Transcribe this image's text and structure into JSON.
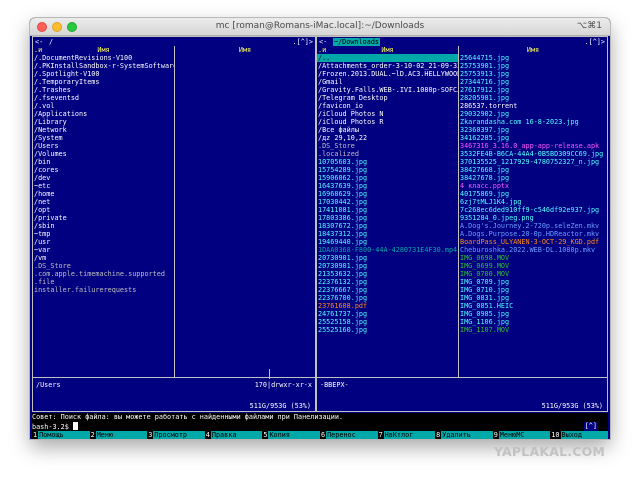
{
  "window": {
    "title": "mc [roman@Romans-iMac.local]:~/Downloads",
    "shortcut": "⌥⌘1"
  },
  "left_panel": {
    "menu": "<-",
    "path": "/",
    "indicator": ".[^]>",
    "col_sort": ".и",
    "col1_header": "Имя",
    "col2_header": "Имя",
    "col1": [
      {
        "name": "/.DocumentRevisions-V100",
        "color": "c-white"
      },
      {
        "name": "/.PKInstallSandbox-r-SystemSoftware",
        "color": "c-white"
      },
      {
        "name": "/.Spotlight-V100",
        "color": "c-white"
      },
      {
        "name": "/.TemporaryItems",
        "color": "c-white"
      },
      {
        "name": "/.Trashes",
        "color": "c-white"
      },
      {
        "name": "/.fseventsd",
        "color": "c-white"
      },
      {
        "name": "/.vol",
        "color": "c-white"
      },
      {
        "name": "/Applications",
        "color": "c-white"
      },
      {
        "name": "/Library",
        "color": "c-white"
      },
      {
        "name": "/Network",
        "color": "c-white"
      },
      {
        "name": "/System",
        "color": "c-white"
      },
      {
        "name": "/Users",
        "color": "c-white"
      },
      {
        "name": "/Volumes",
        "color": "c-white"
      },
      {
        "name": "/bin",
        "color": "c-white"
      },
      {
        "name": "/cores",
        "color": "c-white"
      },
      {
        "name": "/dev",
        "color": "c-white"
      },
      {
        "name": "~etc",
        "color": "c-white"
      },
      {
        "name": "/home",
        "color": "c-white"
      },
      {
        "name": "/net",
        "color": "c-white"
      },
      {
        "name": "/opt",
        "color": "c-white"
      },
      {
        "name": "/private",
        "color": "c-white"
      },
      {
        "name": "/sbin",
        "color": "c-white"
      },
      {
        "name": "~tmp",
        "color": "c-white"
      },
      {
        "name": "/usr",
        "color": "c-white"
      },
      {
        "name": "~var",
        "color": "c-white"
      },
      {
        "name": "/vm",
        "color": "c-white"
      },
      {
        "name": " .DS_Store",
        "color": "c-gray"
      },
      {
        "name": " .com.apple.timemachine.supported",
        "color": "c-gray"
      },
      {
        "name": " .file",
        "color": "c-gray"
      },
      {
        "name": " installer.failurerequests",
        "color": "c-gray"
      }
    ],
    "col2": [],
    "status_name": "/Users",
    "status_info": "170|drwxr-xr-x",
    "disk": "511G/953G (53%)"
  },
  "right_panel": {
    "menu": "<-",
    "path": "~/Downloads",
    "indicator": ".[^]>",
    "col_sort": ".и",
    "col1_header": "Имя",
    "col2_header": "Имя",
    "col1": [
      {
        "name": "/..",
        "color": "c-white",
        "selected": true
      },
      {
        "name": "/Attachments_order-3-10-02_21-09-32",
        "color": "c-white"
      },
      {
        "name": "/Frozen.2013.DUAL.~lD.AC3.HELLYWOOD",
        "color": "c-white"
      },
      {
        "name": "/Gmail",
        "color": "c-white"
      },
      {
        "name": "/Gravity.Falls.WEB-.IVI.1080p-SOFCJ",
        "color": "c-white"
      },
      {
        "name": "/Telegram Desktop",
        "color": "c-white"
      },
      {
        "name": "/favicon_io",
        "color": "c-white"
      },
      {
        "name": "/iCloud Photos N",
        "color": "c-white"
      },
      {
        "name": "/iCloud Photos R",
        "color": "c-white"
      },
      {
        "name": "/Все файлы",
        "color": "c-white"
      },
      {
        "name": "/дz 29,10,22",
        "color": "c-white"
      },
      {
        "name": " .DS_Store",
        "color": "c-gray"
      },
      {
        "name": " .localized",
        "color": "c-gray"
      },
      {
        "name": " 10705603.jpg",
        "color": "c-cyan"
      },
      {
        "name": " 15754289.jpg",
        "color": "c-cyan"
      },
      {
        "name": " 15906062.jpg",
        "color": "c-cyan"
      },
      {
        "name": " 16437639.jpg",
        "color": "c-cyan"
      },
      {
        "name": " 16968629.jpg",
        "color": "c-cyan"
      },
      {
        "name": " 17030442.jpg",
        "color": "c-cyan"
      },
      {
        "name": " 17411081.jpg",
        "color": "c-cyan"
      },
      {
        "name": " 17803386.jpg",
        "color": "c-cyan"
      },
      {
        "name": " 18307672.jpg",
        "color": "c-cyan"
      },
      {
        "name": " 18437312.jpg",
        "color": "c-cyan"
      },
      {
        "name": " 19469440.jpg",
        "color": "c-cyan"
      },
      {
        "name": " 1DAA0368-F800-44A-4280731E4F30.mp4",
        "color": "c-teal"
      },
      {
        "name": " 20730901.jpg",
        "color": "c-cyan"
      },
      {
        "name": " 20730901.jpg",
        "color": "c-cyan"
      },
      {
        "name": " 21353632.jpg",
        "color": "c-cyan"
      },
      {
        "name": " 22376132.jpg",
        "color": "c-cyan"
      },
      {
        "name": " 22376667.jpg",
        "color": "c-cyan"
      },
      {
        "name": " 22376700.jpg",
        "color": "c-cyan"
      },
      {
        "name": " 23761608.pdf",
        "color": "c-orange"
      },
      {
        "name": " 24761737.jpg",
        "color": "c-cyan"
      },
      {
        "name": " 25525158.jpg",
        "color": "c-cyan"
      },
      {
        "name": " 25525160.jpg",
        "color": "c-cyan"
      }
    ],
    "col2": [
      {
        "name": " 25644715.jpg",
        "color": "c-cyan"
      },
      {
        "name": " 25753901.jpg",
        "color": "c-cyan"
      },
      {
        "name": " 25753913.jpg",
        "color": "c-cyan"
      },
      {
        "name": " 27344716.jpg",
        "color": "c-cyan"
      },
      {
        "name": " 27617912.jpg",
        "color": "c-cyan"
      },
      {
        "name": " 28205981.jpg",
        "color": "c-cyan"
      },
      {
        "name": " 286537.torrent",
        "color": "c-white"
      },
      {
        "name": " 29032902.jpg",
        "color": "c-cyan"
      },
      {
        "name": " Zkarandasha.com 16-8-2023.jpg",
        "color": "c-cyan"
      },
      {
        "name": " 32360397.jpg",
        "color": "c-cyan"
      },
      {
        "name": " 34162285.jpg",
        "color": "c-cyan"
      },
      {
        "name": " 3467316_3.16.0_app-app-release.apk",
        "color": "c-magenta"
      },
      {
        "name": " 3532FE4B-B6CA-44A4-0B5BD309CC69.jpg",
        "color": "c-cyan"
      },
      {
        "name": " 370135525_1217929-4780752327_n.jpg",
        "color": "c-cyan"
      },
      {
        "name": " 38427668.jpg",
        "color": "c-cyan"
      },
      {
        "name": " 38427678.jpg",
        "color": "c-cyan"
      },
      {
        "name": " 4 класс.pptx",
        "color": "c-magenta"
      },
      {
        "name": " 40175869.jpg",
        "color": "c-cyan"
      },
      {
        "name": " 6zj7tMLJ1K4.jpg",
        "color": "c-cyan"
      },
      {
        "name": " 7c268ec6ded910ff9-c546df92e937.jpg",
        "color": "c-cyan"
      },
      {
        "name": " 9351284_0.jpeg.png",
        "color": "c-cyan"
      },
      {
        "name": " A.Dog's.Journey.2-720p.seleZen.mkv",
        "color": "c-blue"
      },
      {
        "name": " A.Dogs.Purpose.20-0p.HDReactor.mkv",
        "color": "c-blue"
      },
      {
        "name": " BoardPass_ULYANEN-3-OCT-29_KGD.pdf",
        "color": "c-orange"
      },
      {
        "name": " Cheburoshka.2022.WEB-DL.1080p.mkv",
        "color": "c-blue"
      },
      {
        "name": " IMG_0698.MOV",
        "color": "c-dgreen"
      },
      {
        "name": " IMG_0699.MOV",
        "color": "c-dgreen"
      },
      {
        "name": " IMG_0700.MOV",
        "color": "c-dgreen"
      },
      {
        "name": " IMG_0709.jpg",
        "color": "c-cyan"
      },
      {
        "name": " IMG_0710.jpg",
        "color": "c-cyan"
      },
      {
        "name": " IMG_0831.jpg",
        "color": "c-cyan"
      },
      {
        "name": " IMG_0851.HEIC",
        "color": "c-cyan"
      },
      {
        "name": " IMG_0985.jpg",
        "color": "c-cyan"
      },
      {
        "name": " IMG_1106.jpg",
        "color": "c-cyan"
      },
      {
        "name": " IMG_1107.MOV",
        "color": "c-dgreen"
      }
    ],
    "status_name": "-ВВЕРХ-",
    "status_info": "",
    "disk": "511G/953G (53%)"
  },
  "hint": "Совет: Поиск файла: вы можете работать с найденными файлами при Панелизации.",
  "prompt": "bash-3.2$ ",
  "prompt_scroll": "[^]",
  "fkeys": [
    {
      "num": "1",
      "label": "Помощь"
    },
    {
      "num": "2",
      "label": "Меню"
    },
    {
      "num": "3",
      "label": "Просмотр"
    },
    {
      "num": "4",
      "label": "Правка"
    },
    {
      "num": "5",
      "label": "Копия"
    },
    {
      "num": "6",
      "label": "Перенос"
    },
    {
      "num": "7",
      "label": "НвКтлог"
    },
    {
      "num": "8",
      "label": "Удалить"
    },
    {
      "num": "9",
      "label": "МенюМС"
    },
    {
      "num": "10",
      "label": "Выход"
    }
  ],
  "watermark": "YAPLAKAL.COM"
}
